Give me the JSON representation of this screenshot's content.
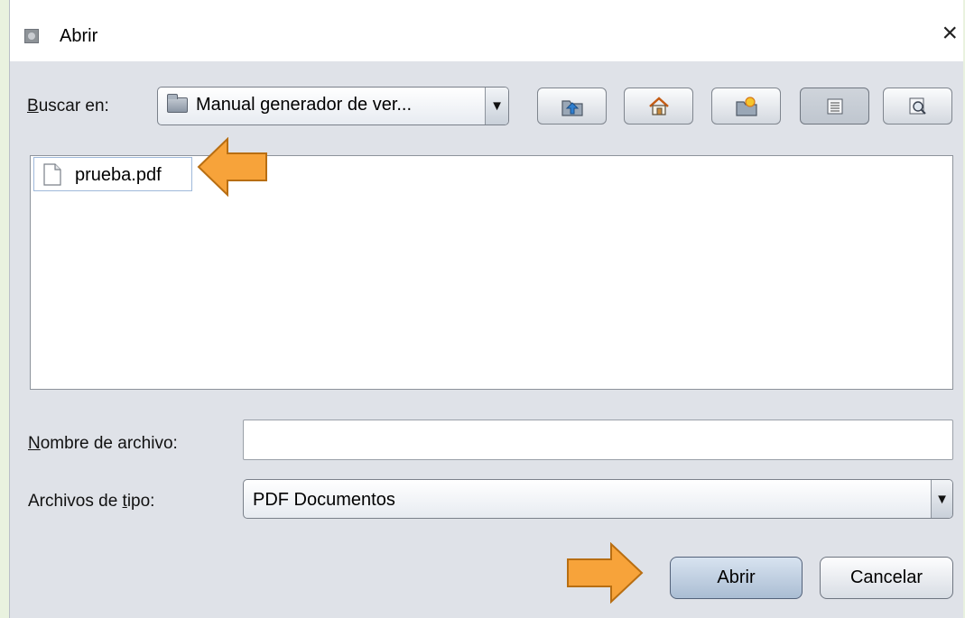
{
  "dialog": {
    "title": "Abrir",
    "close_symbol": "×"
  },
  "look_in": {
    "label_first": "B",
    "label_rest": "uscar en:",
    "value": "Manual generador de ver...",
    "arrow": "▼"
  },
  "toolbar": {
    "buttons": [
      {
        "name": "up-folder-icon"
      },
      {
        "name": "home-icon"
      },
      {
        "name": "new-folder-icon"
      },
      {
        "name": "list-view-icon",
        "active": true
      },
      {
        "name": "details-view-icon"
      }
    ]
  },
  "files": [
    {
      "name": "prueba.pdf",
      "icon": "document-icon"
    }
  ],
  "filename": {
    "label_first": "N",
    "label_rest": "ombre de archivo:",
    "value": ""
  },
  "filetype": {
    "label_before": "Archivos de ",
    "label_mnemonic": "t",
    "label_after": "ipo:",
    "value": "PDF Documentos",
    "arrow": "▼"
  },
  "buttons": {
    "open_label": "Abrir",
    "cancel_label": "Cancelar"
  },
  "annotations": {
    "arrow_color": "#f7a33a",
    "arrow_border": "#b86e12"
  }
}
